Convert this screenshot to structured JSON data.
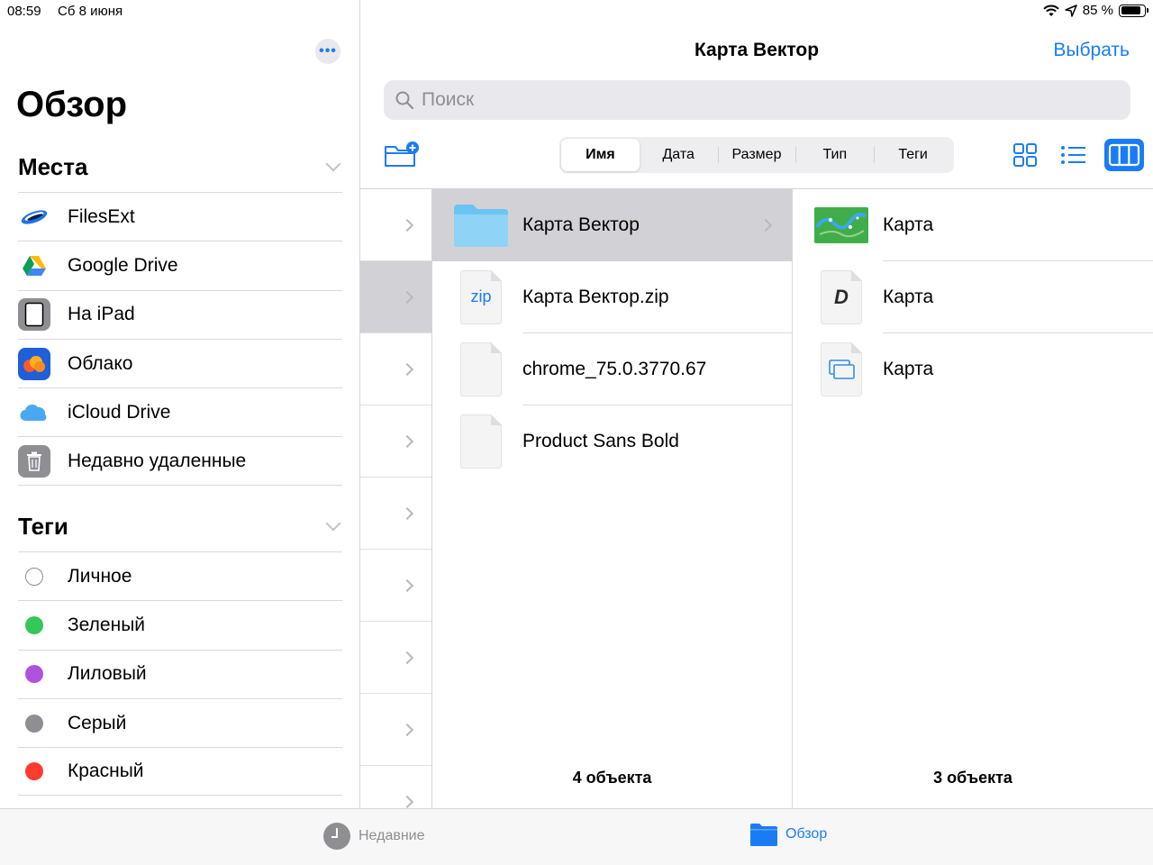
{
  "status": {
    "time": "08:59",
    "date": "Сб 8 июня",
    "battery": "85 %"
  },
  "sidebar": {
    "title": "Обзор",
    "places_header": "Места",
    "places": [
      {
        "label": "FilesExt",
        "icon": "filesext-icon"
      },
      {
        "label": "Google Drive",
        "icon": "google-drive-icon"
      },
      {
        "label": "На iPad",
        "icon": "ipad-icon"
      },
      {
        "label": "Облако",
        "icon": "cloud-app-icon"
      },
      {
        "label": "iCloud Drive",
        "icon": "icloud-icon"
      },
      {
        "label": "Недавно удаленные",
        "icon": "trash-icon"
      }
    ],
    "tags_header": "Теги",
    "tags": [
      {
        "label": "Личное",
        "color": "none"
      },
      {
        "label": "Зеленый",
        "color": "#34c759"
      },
      {
        "label": "Лиловый",
        "color": "#af52de"
      },
      {
        "label": "Серый",
        "color": "#8e8e93"
      },
      {
        "label": "Красный",
        "color": "#ff3b30"
      }
    ]
  },
  "header": {
    "title": "Карта Вектор",
    "select_label": "Выбрать"
  },
  "search": {
    "placeholder": "Поиск"
  },
  "sort": {
    "options": [
      "Имя",
      "Дата",
      "Размер",
      "Тип",
      "Теги"
    ],
    "active": "Имя"
  },
  "column1": {
    "items": [
      {
        "name": "Карта Вектор",
        "kind": "folder"
      },
      {
        "name": "Карта Вектор.zip",
        "kind": "zip",
        "badge": "zip"
      },
      {
        "name": "chrome_75.0.3770.67",
        "kind": "file"
      },
      {
        "name": "Product Sans Bold",
        "kind": "file"
      }
    ],
    "count": "4 объекта"
  },
  "column2": {
    "items": [
      {
        "name": "Карта",
        "kind": "image"
      },
      {
        "name": "Карта",
        "kind": "d-doc",
        "badge": "D"
      },
      {
        "name": "Карта",
        "kind": "window-doc"
      }
    ],
    "count": "3 объекта"
  },
  "tabbar": {
    "recent": "Недавние",
    "browse": "Обзор"
  },
  "colors": {
    "accent": "#1a7cf5"
  }
}
